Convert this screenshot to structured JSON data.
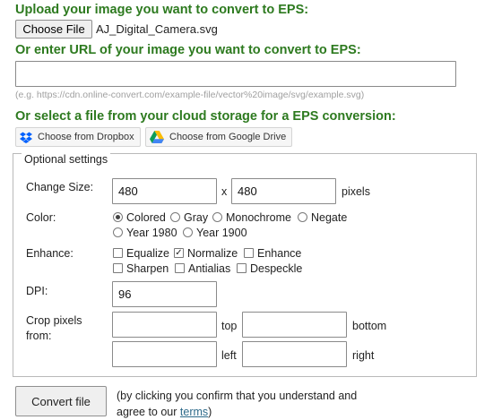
{
  "upload": {
    "heading": "Upload your image you want to convert to EPS:",
    "choose_button": "Choose File",
    "file_name": "AJ_Digital_Camera.svg"
  },
  "url": {
    "heading": "Or enter URL of your image you want to convert to EPS:",
    "value": "",
    "example": "(e.g. https://cdn.online-convert.com/example-file/vector%20image/svg/example.svg)"
  },
  "cloud": {
    "heading": "Or select a file from your cloud storage for a EPS conversion:",
    "dropbox_label": "Choose from Dropbox",
    "gdrive_label": "Choose from Google Drive"
  },
  "options": {
    "legend": "Optional settings",
    "change_size": {
      "label": "Change Size:",
      "width": "480",
      "separator": "x",
      "height": "480",
      "unit": "pixels"
    },
    "color": {
      "label": "Color:",
      "options": [
        "Colored",
        "Gray",
        "Monochrome",
        "Negate",
        "Year 1980",
        "Year 1900"
      ],
      "selected": "Colored"
    },
    "enhance": {
      "label": "Enhance:",
      "options": [
        "Equalize",
        "Normalize",
        "Enhance",
        "Sharpen",
        "Antialias",
        "Despeckle"
      ],
      "checked": [
        "Normalize"
      ]
    },
    "dpi": {
      "label": "DPI:",
      "value": "96"
    },
    "crop": {
      "label_line1": "Crop pixels",
      "label_line2": "from:",
      "top_label": "top",
      "bottom_label": "bottom",
      "left_label": "left",
      "right_label": "right",
      "top": "",
      "bottom": "",
      "left": "",
      "right": ""
    }
  },
  "footer": {
    "convert_button": "Convert file",
    "note_line1": "(by clicking you confirm that you understand and",
    "note_line2_prefix": "agree to our ",
    "terms_link": "terms",
    "note_line2_suffix": ")"
  },
  "colors": {
    "heading": "#2d7a1f",
    "dropbox": "#0061fe",
    "link": "#2d6a8a"
  }
}
